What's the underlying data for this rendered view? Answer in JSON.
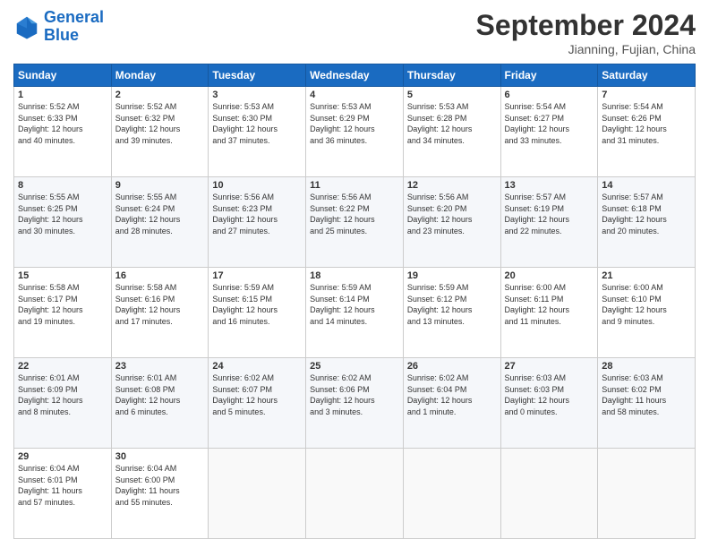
{
  "header": {
    "logo_line1": "General",
    "logo_line2": "Blue",
    "main_title": "September 2024",
    "subtitle": "Jianning, Fujian, China"
  },
  "days_of_week": [
    "Sunday",
    "Monday",
    "Tuesday",
    "Wednesday",
    "Thursday",
    "Friday",
    "Saturday"
  ],
  "weeks": [
    [
      {
        "day": "1",
        "info": "Sunrise: 5:52 AM\nSunset: 6:33 PM\nDaylight: 12 hours\nand 40 minutes."
      },
      {
        "day": "2",
        "info": "Sunrise: 5:52 AM\nSunset: 6:32 PM\nDaylight: 12 hours\nand 39 minutes."
      },
      {
        "day": "3",
        "info": "Sunrise: 5:53 AM\nSunset: 6:30 PM\nDaylight: 12 hours\nand 37 minutes."
      },
      {
        "day": "4",
        "info": "Sunrise: 5:53 AM\nSunset: 6:29 PM\nDaylight: 12 hours\nand 36 minutes."
      },
      {
        "day": "5",
        "info": "Sunrise: 5:53 AM\nSunset: 6:28 PM\nDaylight: 12 hours\nand 34 minutes."
      },
      {
        "day": "6",
        "info": "Sunrise: 5:54 AM\nSunset: 6:27 PM\nDaylight: 12 hours\nand 33 minutes."
      },
      {
        "day": "7",
        "info": "Sunrise: 5:54 AM\nSunset: 6:26 PM\nDaylight: 12 hours\nand 31 minutes."
      }
    ],
    [
      {
        "day": "8",
        "info": "Sunrise: 5:55 AM\nSunset: 6:25 PM\nDaylight: 12 hours\nand 30 minutes."
      },
      {
        "day": "9",
        "info": "Sunrise: 5:55 AM\nSunset: 6:24 PM\nDaylight: 12 hours\nand 28 minutes."
      },
      {
        "day": "10",
        "info": "Sunrise: 5:56 AM\nSunset: 6:23 PM\nDaylight: 12 hours\nand 27 minutes."
      },
      {
        "day": "11",
        "info": "Sunrise: 5:56 AM\nSunset: 6:22 PM\nDaylight: 12 hours\nand 25 minutes."
      },
      {
        "day": "12",
        "info": "Sunrise: 5:56 AM\nSunset: 6:20 PM\nDaylight: 12 hours\nand 23 minutes."
      },
      {
        "day": "13",
        "info": "Sunrise: 5:57 AM\nSunset: 6:19 PM\nDaylight: 12 hours\nand 22 minutes."
      },
      {
        "day": "14",
        "info": "Sunrise: 5:57 AM\nSunset: 6:18 PM\nDaylight: 12 hours\nand 20 minutes."
      }
    ],
    [
      {
        "day": "15",
        "info": "Sunrise: 5:58 AM\nSunset: 6:17 PM\nDaylight: 12 hours\nand 19 minutes."
      },
      {
        "day": "16",
        "info": "Sunrise: 5:58 AM\nSunset: 6:16 PM\nDaylight: 12 hours\nand 17 minutes."
      },
      {
        "day": "17",
        "info": "Sunrise: 5:59 AM\nSunset: 6:15 PM\nDaylight: 12 hours\nand 16 minutes."
      },
      {
        "day": "18",
        "info": "Sunrise: 5:59 AM\nSunset: 6:14 PM\nDaylight: 12 hours\nand 14 minutes."
      },
      {
        "day": "19",
        "info": "Sunrise: 5:59 AM\nSunset: 6:12 PM\nDaylight: 12 hours\nand 13 minutes."
      },
      {
        "day": "20",
        "info": "Sunrise: 6:00 AM\nSunset: 6:11 PM\nDaylight: 12 hours\nand 11 minutes."
      },
      {
        "day": "21",
        "info": "Sunrise: 6:00 AM\nSunset: 6:10 PM\nDaylight: 12 hours\nand 9 minutes."
      }
    ],
    [
      {
        "day": "22",
        "info": "Sunrise: 6:01 AM\nSunset: 6:09 PM\nDaylight: 12 hours\nand 8 minutes."
      },
      {
        "day": "23",
        "info": "Sunrise: 6:01 AM\nSunset: 6:08 PM\nDaylight: 12 hours\nand 6 minutes."
      },
      {
        "day": "24",
        "info": "Sunrise: 6:02 AM\nSunset: 6:07 PM\nDaylight: 12 hours\nand 5 minutes."
      },
      {
        "day": "25",
        "info": "Sunrise: 6:02 AM\nSunset: 6:06 PM\nDaylight: 12 hours\nand 3 minutes."
      },
      {
        "day": "26",
        "info": "Sunrise: 6:02 AM\nSunset: 6:04 PM\nDaylight: 12 hours\nand 1 minute."
      },
      {
        "day": "27",
        "info": "Sunrise: 6:03 AM\nSunset: 6:03 PM\nDaylight: 12 hours\nand 0 minutes."
      },
      {
        "day": "28",
        "info": "Sunrise: 6:03 AM\nSunset: 6:02 PM\nDaylight: 11 hours\nand 58 minutes."
      }
    ],
    [
      {
        "day": "29",
        "info": "Sunrise: 6:04 AM\nSunset: 6:01 PM\nDaylight: 11 hours\nand 57 minutes."
      },
      {
        "day": "30",
        "info": "Sunrise: 6:04 AM\nSunset: 6:00 PM\nDaylight: 11 hours\nand 55 minutes."
      },
      {
        "day": "",
        "info": ""
      },
      {
        "day": "",
        "info": ""
      },
      {
        "day": "",
        "info": ""
      },
      {
        "day": "",
        "info": ""
      },
      {
        "day": "",
        "info": ""
      }
    ]
  ]
}
